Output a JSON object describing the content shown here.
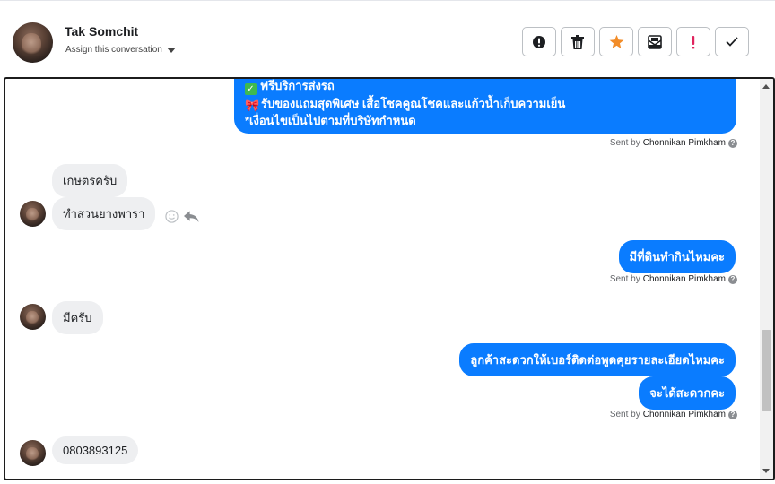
{
  "header": {
    "contact_name": "Tak Somchit",
    "assign_label": "Assign this conversation",
    "toolbar": [
      {
        "name": "spam-button",
        "icon": "alert-circle-icon"
      },
      {
        "name": "delete-button",
        "icon": "trash-icon"
      },
      {
        "name": "star-button",
        "icon": "star-icon",
        "color": "#f28c28"
      },
      {
        "name": "mark-unread-button",
        "icon": "envelope-icon"
      },
      {
        "name": "important-button",
        "icon": "exclamation-icon",
        "color": "#e0245e"
      },
      {
        "name": "done-button",
        "icon": "check-icon"
      }
    ]
  },
  "chat": {
    "top_message": {
      "line1": "ฟรีบริการส่งรถ",
      "line2": "รับของแถมสุดพิเศษ เสื้อโชคคูณโชคและแก้วน้ำเก็บความเย็น",
      "line3": "*เงื่อนไขเป็นไปตามที่บริษัทกำหนด"
    },
    "sent_by_prefix": "Sent by",
    "agent_name": "Chonnikan Pimkham",
    "help_glyph": "?",
    "messages": [
      {
        "direction": "in",
        "text": "เกษตรครับ"
      },
      {
        "direction": "in",
        "text": "ทำสวนยางพารา"
      },
      {
        "direction": "out",
        "text": "มีที่ดินทำกินไหมคะ"
      },
      {
        "direction": "in",
        "text": "มีครับ"
      },
      {
        "direction": "out",
        "text": "ลูกค้าสะดวกให้เบอร์ติดต่อพูดคุยรายละเอียดไหมคะ"
      },
      {
        "direction": "out",
        "text": "จะได้สะดวกคะ"
      },
      {
        "direction": "in",
        "text": "0803893125"
      }
    ]
  },
  "colors": {
    "outgoing_bubble": "#0a7cff",
    "incoming_bubble": "#eeeff1"
  }
}
